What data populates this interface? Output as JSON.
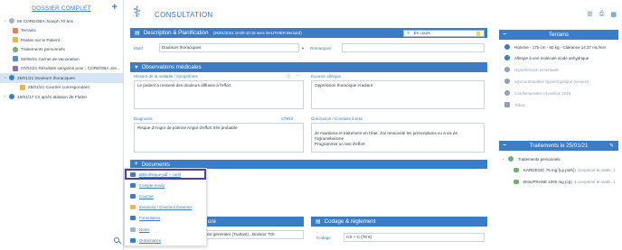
{
  "sidebar": {
    "title": "DOSSIER COMPLET",
    "patient": "Mr CORDOBA Joseph 70 ans",
    "items": [
      {
        "label": "Terrains",
        "color": "#e57f5c"
      },
      {
        "label": "Pastes sur le Patient",
        "color": "#e8b64c"
      },
      {
        "label": "Traitements personnels",
        "color": "#6db36d"
      },
      {
        "label": "02/06/21 Carnet de vaccination",
        "color": "#4f91d6"
      },
      {
        "label": "07/04/21 Résultats sanguins pour : CORDOBA Jos...",
        "color": "#8a6cc9"
      },
      {
        "label": "25/01/21 Douleurs thoraciques",
        "color": "#3a7dc6"
      },
      {
        "label": "25/01/21 Courrier correspondant",
        "color": "#e8b64c"
      },
      {
        "label": "19/01/17 Cs après ablation de Flutter",
        "color": "#3a7dc6"
      }
    ]
  },
  "header": {
    "title": "CONSULTATION",
    "icons": [
      "list-icon",
      "print-icon",
      "calendar-icon"
    ]
  },
  "description": {
    "title": "Description  & Planification",
    "meta": "(25/01/2021 10:00-10:15 avec BAUTHIER Bernard)",
    "status_value": "En cours",
    "motif_label": "Motif",
    "motif_value": "Douleurs thoraciques",
    "remarques_label": "Remarques"
  },
  "observations": {
    "title": "Observations médicales",
    "histoire_label": "Histoire de la maladie / Symptômes",
    "histoire_value": "Le patient a ressenti des douleurs diffuses à l'effort.",
    "examen_label": "Examen clinique",
    "examen_value": "Oppression thoracique irradiant",
    "diagnostic_label": "Diagnostic",
    "cim_label": "CIM10",
    "diagnostic_value": "Risque d'Angor de poitrine Angor d'effort très probable",
    "conclusion_label": "Conclusion / Conduite à tenir",
    "conclusion_value": "Je maintiens le traitement en l'état. J'ai renouvelé les prescriptions vu à vis de l'ogramsboisme.\nProgrammer un test d'effort"
  },
  "documents": {
    "title": "Documents",
    "items": [
      {
        "label": "Bibliothèque pdf + certif",
        "color": "#3a7dc6"
      },
      {
        "label": "Compte-rendu",
        "color": "#3a7dc6"
      },
      {
        "label": "Courrier",
        "color": "#3a7dc6"
      },
      {
        "label": "Examens / Courriers Externes",
        "color": "#e8b64c"
      },
      {
        "label": "Formulaires",
        "color": "#3a7dc6"
      },
      {
        "label": "Notes",
        "color": "#3a7dc6"
      },
      {
        "label": "Ordonnance",
        "color": "#3a7dc6"
      }
    ]
  },
  "bottom_left": {
    "title_fragment": "ure",
    "text": "tia (Médecine générale) (Traitant) , Docteur TOI"
  },
  "codage": {
    "title": "Codage & règlement",
    "label": "Codage",
    "value": "CS + C (76 €)"
  },
  "terrains": {
    "title": "Terrains",
    "rows": [
      {
        "text": "Homme - 175 cm - 60 kg - Clairance 14,37 mL/min",
        "color": "#3a7dc6"
      },
      {
        "text": "Allergie à une molécule acide anhydrique",
        "color": "#3a7dc6"
      },
      {
        "text": "Hypertension essentielle",
        "color": "#8ea3b8"
      },
      {
        "text": "Myocardiopathie hypertrophique (sévère)",
        "color": "#8ea3b8"
      },
      {
        "text": "Cardiomyosites et Holsoc 2018",
        "color": "#8ea3b8"
      },
      {
        "text": "Tabac",
        "color": "#8ea3b8"
      }
    ]
  },
  "traitements": {
    "title": "Traitements  le 25/01/21",
    "group": "Traitements personnels",
    "rows": [
      {
        "name": "KARDEGIC 75 mg (Lp poth)",
        "dose": "1 comprimé le matin, 1"
      },
      {
        "name": "DOLIPRANE 1000 mg (cp)",
        "dose": "1 comprimé le matin, 1"
      }
    ]
  }
}
